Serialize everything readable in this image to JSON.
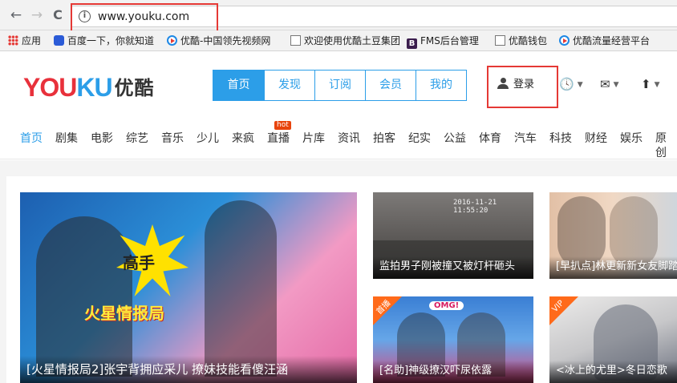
{
  "browser": {
    "url": "www.youku.com",
    "back": "←",
    "forward": "→",
    "reload": "C",
    "info": "i"
  },
  "bookmarks": [
    {
      "label": "应用",
      "icon": "apps-icon"
    },
    {
      "label": "百度一下，你就知道",
      "icon": "baidu-paw-icon"
    },
    {
      "label": "优酷-中国领先视频网",
      "icon": "youku-play-icon"
    },
    {
      "label": "欢迎使用优酷土豆集团",
      "icon": "document-icon"
    },
    {
      "label": "FMS后台管理",
      "icon": "b-logo-icon"
    },
    {
      "label": "优酷钱包",
      "icon": "document-icon"
    },
    {
      "label": "优酷流量经营平台",
      "icon": "youku-play-icon"
    }
  ],
  "logo": {
    "part1": "YOU",
    "part2": "KU",
    "cn": "优酷"
  },
  "topnav": [
    "首页",
    "发现",
    "订阅",
    "会员",
    "我的"
  ],
  "header": {
    "login": "登录",
    "history_icon": "clock-icon",
    "message_icon": "envelope-icon",
    "upload_icon": "upload-icon",
    "history_glyph": "🕓",
    "message_glyph": "✉",
    "upload_glyph": "⬆",
    "caret": "▼"
  },
  "channels": [
    "首页",
    "剧集",
    "电影",
    "综艺",
    "音乐",
    "少儿",
    "来疯",
    "直播",
    "片库",
    "资讯",
    "拍客",
    "纪实",
    "公益",
    "体育",
    "汽车",
    "科技",
    "财经",
    "娱乐",
    "原创"
  ],
  "hot_badge": "hot",
  "videos": {
    "big": {
      "caption": "[火星情报局2]张宇背拥应采儿 撩妹技能看傻汪涵",
      "burst": "高手",
      "show_logo": "火星情报局"
    },
    "t1": {
      "caption": "监拍男子刚被撞又被灯杆砸头",
      "timestamp": "2016-11-21 11:55:20"
    },
    "t2": {
      "caption": "[早扒点]林更新新女友脚踏三"
    },
    "t3": {
      "caption": "[名助]神级撩汉吓尿依露",
      "tag": "首播",
      "sticker": "OMG!"
    },
    "t4": {
      "caption": "<冰上的尤里>冬日恋歌",
      "tag": "VIP"
    }
  },
  "colors": {
    "accent": "#2c9ee8",
    "logo_red": "#e8313b",
    "highlight": "#e53935",
    "hot": "#e8440d"
  }
}
